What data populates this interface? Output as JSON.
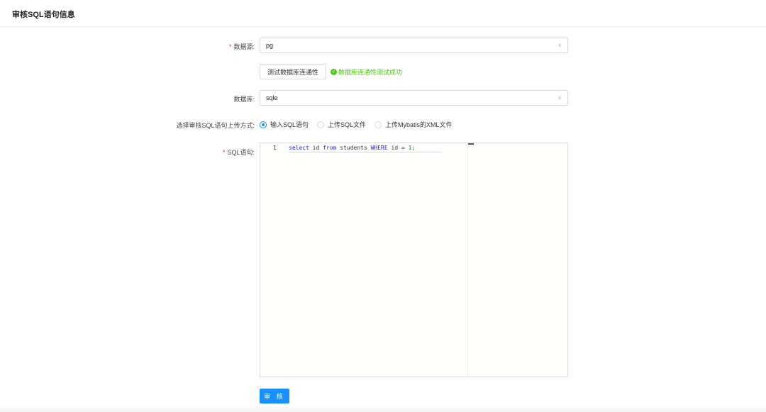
{
  "header": {
    "title": "审核SQL语句信息"
  },
  "form": {
    "datasource": {
      "label": "数据源:",
      "value": "pg",
      "required": true
    },
    "test_button": "测试数据库连通性",
    "test_result": "数据库连通性测试成功",
    "database": {
      "label": "数据库:",
      "value": "sqle"
    },
    "upload_mode": {
      "label": "选择审核SQL语句上传方式:",
      "options": [
        "输入SQL语句",
        "上传SQL文件",
        "上传Mybatis的XML文件"
      ],
      "selected": "输入SQL语句"
    },
    "sql": {
      "label": "SQL语句:",
      "required": true,
      "line_number": "1",
      "tokens": {
        "select": "select",
        "id": " id ",
        "from": "from",
        "students": " students ",
        "where": "WHERE",
        "id2": " id = ",
        "one": "1",
        "semi": ";"
      }
    },
    "submit": "审 核"
  },
  "colors": {
    "primary": "#1890ff",
    "success": "#52c41a",
    "required": "#f5222d"
  }
}
